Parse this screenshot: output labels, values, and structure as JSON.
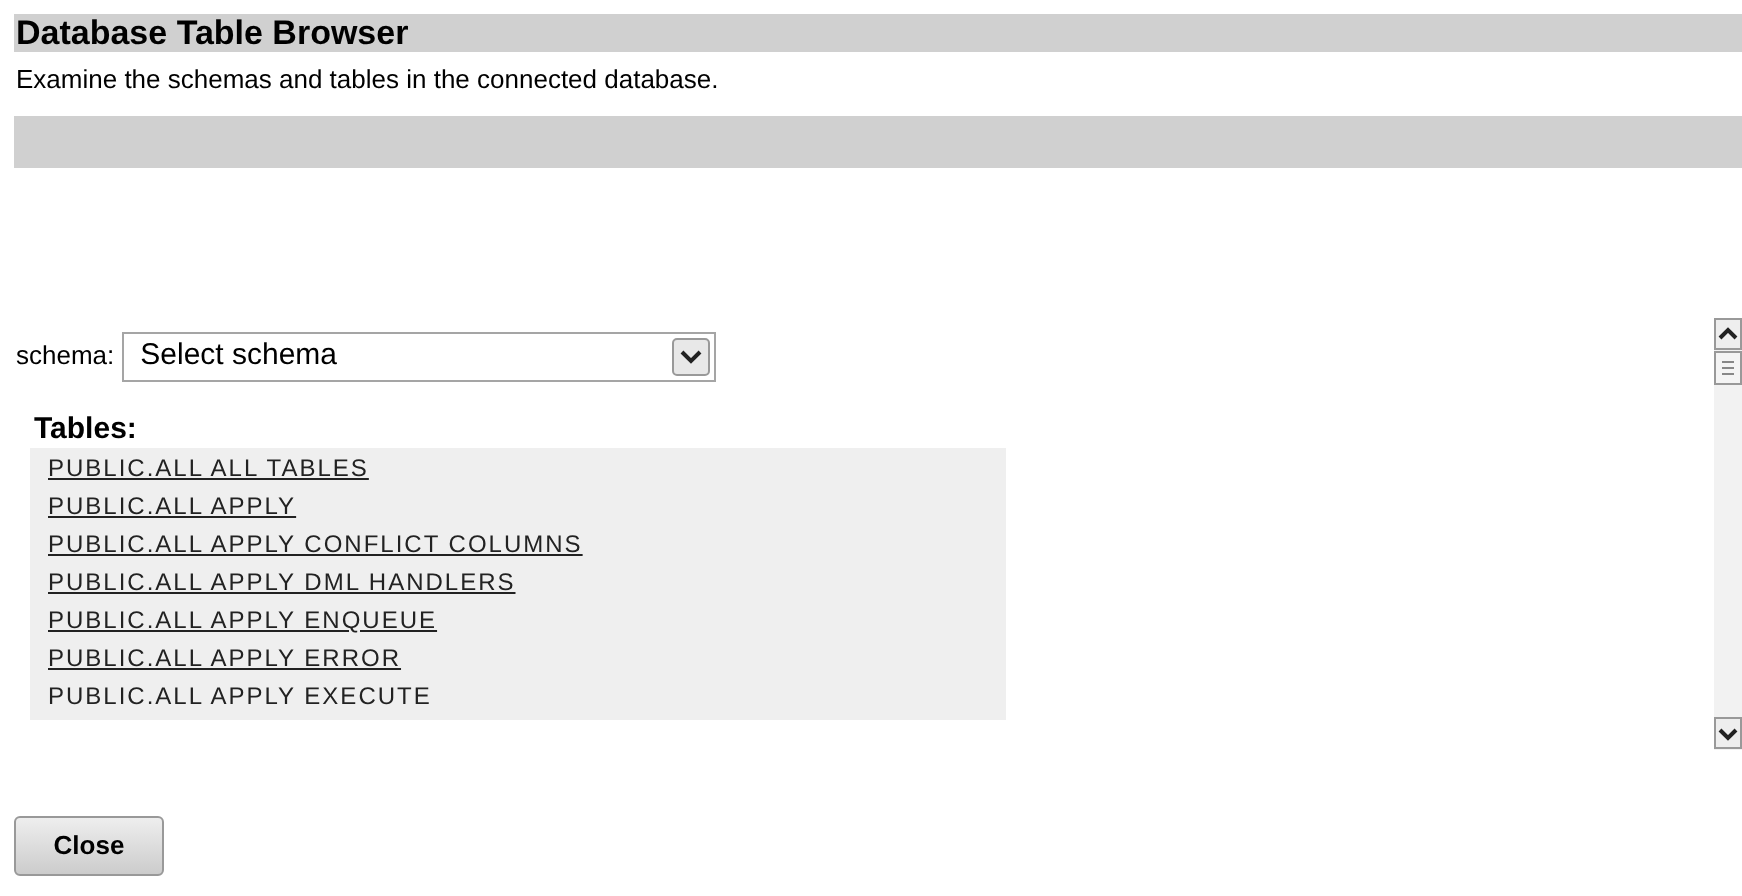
{
  "header": {
    "title": "Database Table Browser",
    "description": "Examine the schemas and tables in the connected database."
  },
  "schema": {
    "label": "schema:",
    "placeholder": "Select schema"
  },
  "tables": {
    "heading": "Tables:",
    "items": [
      {
        "name": "PUBLIC.ALL ALL TABLES",
        "kind": "link"
      },
      {
        "name": "PUBLIC.ALL APPLY",
        "kind": "link"
      },
      {
        "name": "PUBLIC.ALL APPLY CONFLICT COLUMNS",
        "kind": "link"
      },
      {
        "name": "PUBLIC.ALL APPLY DML HANDLERS",
        "kind": "link"
      },
      {
        "name": "PUBLIC.ALL APPLY ENQUEUE",
        "kind": "link"
      },
      {
        "name": "PUBLIC.ALL APPLY ERROR",
        "kind": "link"
      },
      {
        "name": "PUBLIC.ALL APPLY EXECUTE",
        "kind": "text"
      }
    ]
  },
  "buttons": [
    "Close"
  ]
}
